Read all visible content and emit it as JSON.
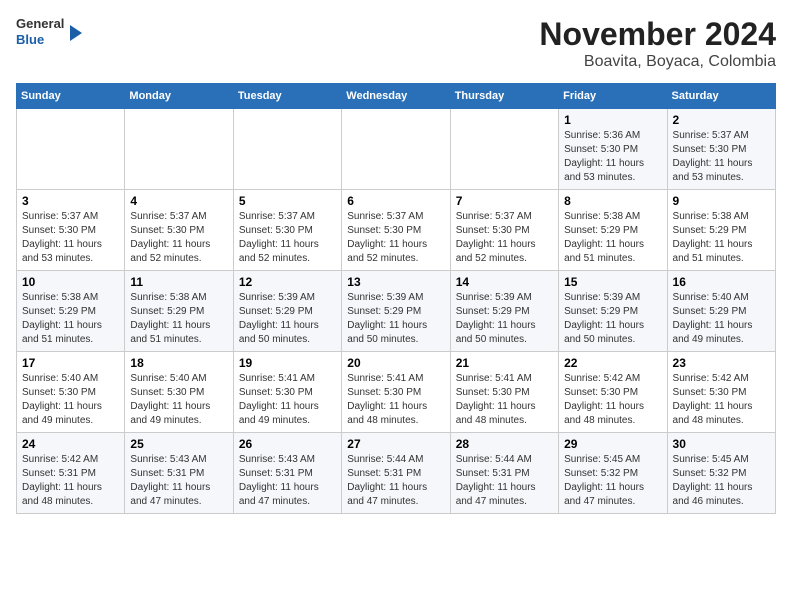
{
  "header": {
    "logo_general": "General",
    "logo_blue": "Blue",
    "title": "November 2024",
    "subtitle": "Boavita, Boyaca, Colombia"
  },
  "weekdays": [
    "Sunday",
    "Monday",
    "Tuesday",
    "Wednesday",
    "Thursday",
    "Friday",
    "Saturday"
  ],
  "weeks": [
    [
      {
        "day": "",
        "info": ""
      },
      {
        "day": "",
        "info": ""
      },
      {
        "day": "",
        "info": ""
      },
      {
        "day": "",
        "info": ""
      },
      {
        "day": "",
        "info": ""
      },
      {
        "day": "1",
        "info": "Sunrise: 5:36 AM\nSunset: 5:30 PM\nDaylight: 11 hours and 53 minutes."
      },
      {
        "day": "2",
        "info": "Sunrise: 5:37 AM\nSunset: 5:30 PM\nDaylight: 11 hours and 53 minutes."
      }
    ],
    [
      {
        "day": "3",
        "info": "Sunrise: 5:37 AM\nSunset: 5:30 PM\nDaylight: 11 hours and 53 minutes."
      },
      {
        "day": "4",
        "info": "Sunrise: 5:37 AM\nSunset: 5:30 PM\nDaylight: 11 hours and 52 minutes."
      },
      {
        "day": "5",
        "info": "Sunrise: 5:37 AM\nSunset: 5:30 PM\nDaylight: 11 hours and 52 minutes."
      },
      {
        "day": "6",
        "info": "Sunrise: 5:37 AM\nSunset: 5:30 PM\nDaylight: 11 hours and 52 minutes."
      },
      {
        "day": "7",
        "info": "Sunrise: 5:37 AM\nSunset: 5:30 PM\nDaylight: 11 hours and 52 minutes."
      },
      {
        "day": "8",
        "info": "Sunrise: 5:38 AM\nSunset: 5:29 PM\nDaylight: 11 hours and 51 minutes."
      },
      {
        "day": "9",
        "info": "Sunrise: 5:38 AM\nSunset: 5:29 PM\nDaylight: 11 hours and 51 minutes."
      }
    ],
    [
      {
        "day": "10",
        "info": "Sunrise: 5:38 AM\nSunset: 5:29 PM\nDaylight: 11 hours and 51 minutes."
      },
      {
        "day": "11",
        "info": "Sunrise: 5:38 AM\nSunset: 5:29 PM\nDaylight: 11 hours and 51 minutes."
      },
      {
        "day": "12",
        "info": "Sunrise: 5:39 AM\nSunset: 5:29 PM\nDaylight: 11 hours and 50 minutes."
      },
      {
        "day": "13",
        "info": "Sunrise: 5:39 AM\nSunset: 5:29 PM\nDaylight: 11 hours and 50 minutes."
      },
      {
        "day": "14",
        "info": "Sunrise: 5:39 AM\nSunset: 5:29 PM\nDaylight: 11 hours and 50 minutes."
      },
      {
        "day": "15",
        "info": "Sunrise: 5:39 AM\nSunset: 5:29 PM\nDaylight: 11 hours and 50 minutes."
      },
      {
        "day": "16",
        "info": "Sunrise: 5:40 AM\nSunset: 5:29 PM\nDaylight: 11 hours and 49 minutes."
      }
    ],
    [
      {
        "day": "17",
        "info": "Sunrise: 5:40 AM\nSunset: 5:30 PM\nDaylight: 11 hours and 49 minutes."
      },
      {
        "day": "18",
        "info": "Sunrise: 5:40 AM\nSunset: 5:30 PM\nDaylight: 11 hours and 49 minutes."
      },
      {
        "day": "19",
        "info": "Sunrise: 5:41 AM\nSunset: 5:30 PM\nDaylight: 11 hours and 49 minutes."
      },
      {
        "day": "20",
        "info": "Sunrise: 5:41 AM\nSunset: 5:30 PM\nDaylight: 11 hours and 48 minutes."
      },
      {
        "day": "21",
        "info": "Sunrise: 5:41 AM\nSunset: 5:30 PM\nDaylight: 11 hours and 48 minutes."
      },
      {
        "day": "22",
        "info": "Sunrise: 5:42 AM\nSunset: 5:30 PM\nDaylight: 11 hours and 48 minutes."
      },
      {
        "day": "23",
        "info": "Sunrise: 5:42 AM\nSunset: 5:30 PM\nDaylight: 11 hours and 48 minutes."
      }
    ],
    [
      {
        "day": "24",
        "info": "Sunrise: 5:42 AM\nSunset: 5:31 PM\nDaylight: 11 hours and 48 minutes."
      },
      {
        "day": "25",
        "info": "Sunrise: 5:43 AM\nSunset: 5:31 PM\nDaylight: 11 hours and 47 minutes."
      },
      {
        "day": "26",
        "info": "Sunrise: 5:43 AM\nSunset: 5:31 PM\nDaylight: 11 hours and 47 minutes."
      },
      {
        "day": "27",
        "info": "Sunrise: 5:44 AM\nSunset: 5:31 PM\nDaylight: 11 hours and 47 minutes."
      },
      {
        "day": "28",
        "info": "Sunrise: 5:44 AM\nSunset: 5:31 PM\nDaylight: 11 hours and 47 minutes."
      },
      {
        "day": "29",
        "info": "Sunrise: 5:45 AM\nSunset: 5:32 PM\nDaylight: 11 hours and 47 minutes."
      },
      {
        "day": "30",
        "info": "Sunrise: 5:45 AM\nSunset: 5:32 PM\nDaylight: 11 hours and 46 minutes."
      }
    ]
  ]
}
